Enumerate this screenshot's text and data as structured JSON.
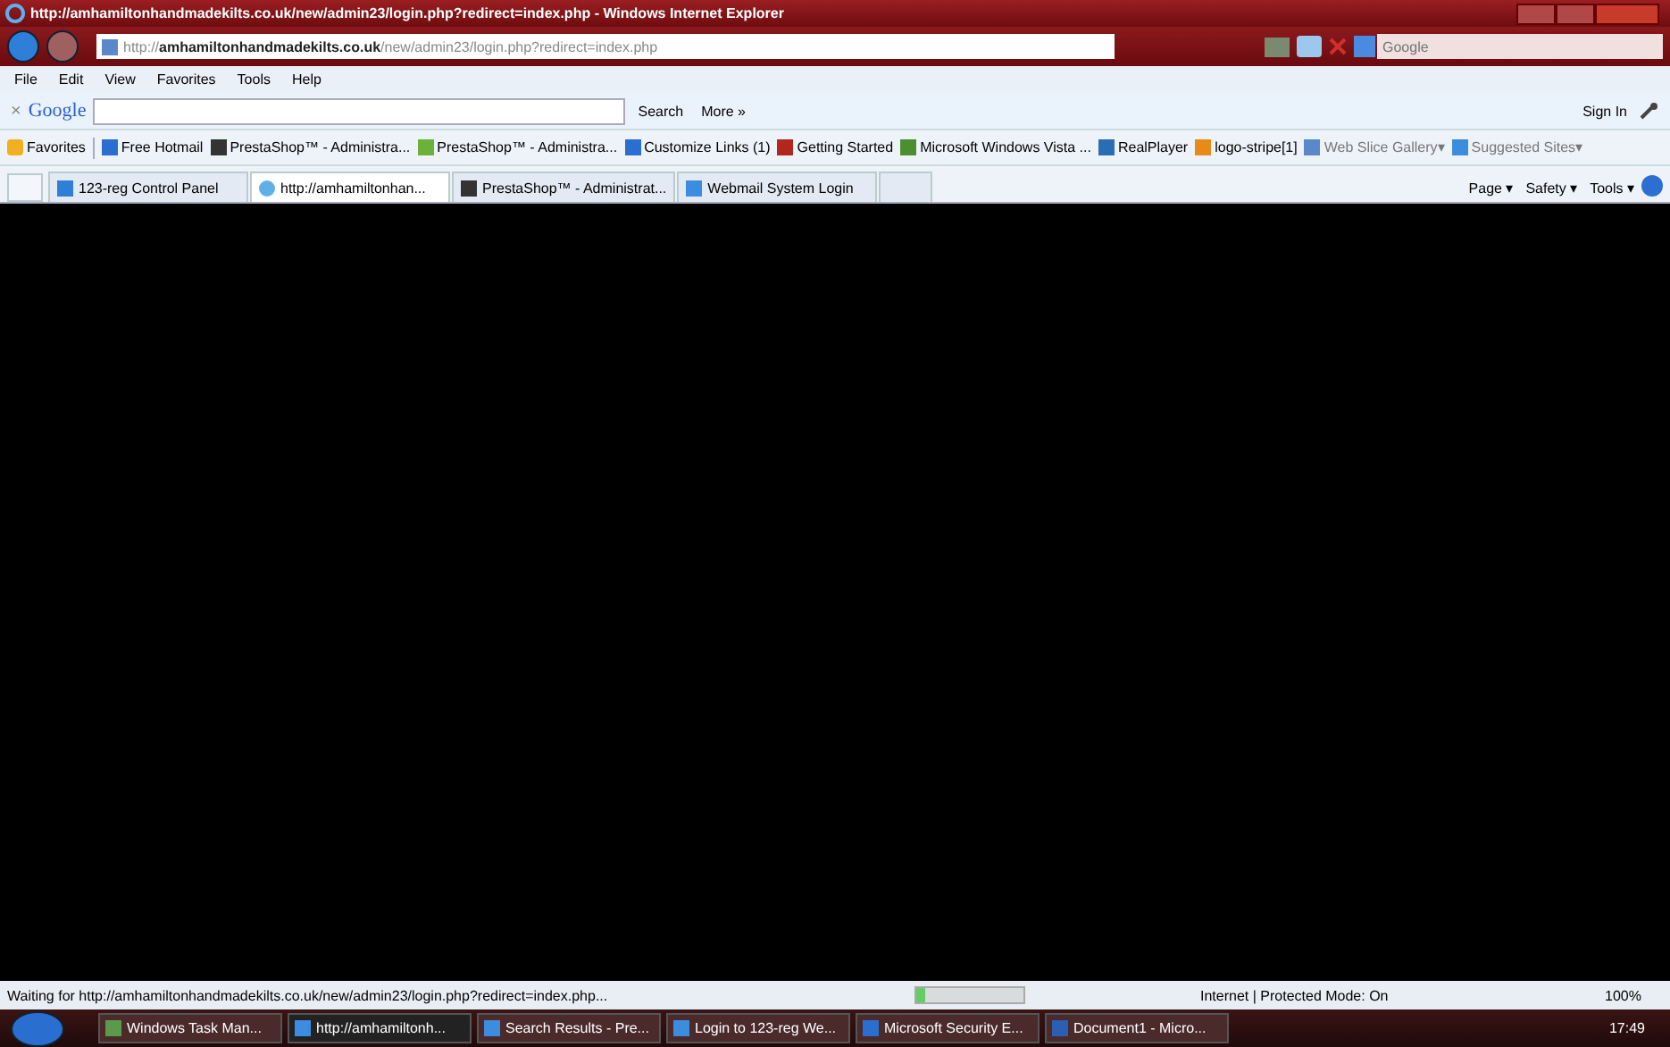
{
  "window": {
    "title": "http://amhamiltonhandmadekilts.co.uk/new/admin23/login.php?redirect=index.php - Windows Internet Explorer"
  },
  "address_bar": {
    "value": "http://**amhamiltonhandmadekilts.co.uk**/new/admin23/login.php?redirect=index.php",
    "search_placeholder": "Google"
  },
  "menu": [
    "File",
    "Edit",
    "View",
    "Favorites",
    "Tools",
    "Help"
  ],
  "google_toolbar": {
    "close": "×",
    "logo": "Google",
    "search": "Search",
    "more": "More »",
    "sign_in": "Sign In"
  },
  "favorites_bar": {
    "label": "Favorites",
    "items": [
      {
        "label": "Free Hotmail",
        "kind": "msn"
      },
      {
        "label": "PrestaShop™ - Administra...",
        "kind": "dark"
      },
      {
        "label": "PrestaShop™ - Administra...",
        "kind": "green"
      },
      {
        "label": "Customize Links (1)",
        "kind": "msn"
      },
      {
        "label": "Getting Started",
        "kind": "red"
      },
      {
        "label": "Microsoft Windows Vista ...",
        "kind": "globe"
      },
      {
        "label": "RealPlayer",
        "kind": "real"
      },
      {
        "label": "logo-stripe[1]",
        "kind": "orange"
      },
      {
        "label": "Web Slice Gallery",
        "kind": "page",
        "dropdown": "▾"
      },
      {
        "label": "Suggested Sites",
        "kind": "ie",
        "dropdown": "▾"
      }
    ]
  },
  "tabs": [
    {
      "label": "123-reg Control Panel",
      "selected": false,
      "kind": "reg"
    },
    {
      "label": "http://amhamiltonhan...",
      "selected": true,
      "kind": "loading"
    },
    {
      "label": "PrestaShop™ - Administrat...",
      "selected": false,
      "kind": "dark"
    },
    {
      "label": "Webmail System Login",
      "selected": false,
      "kind": "ie"
    }
  ],
  "command_bar": [
    {
      "label": "Page",
      "caret": "▾"
    },
    {
      "label": "Safety",
      "caret": "▾"
    },
    {
      "label": "Tools",
      "caret": "▾"
    }
  ],
  "status_bar": {
    "text": "Waiting for http://amhamiltonhandmadekilts.co.uk/new/admin23/login.php?redirect=index.php...",
    "level": 0.08,
    "zone": "Internet | Protected Mode: On",
    "zoom": "100%"
  },
  "taskbar": {
    "items": [
      {
        "label": "Windows Task Man...",
        "selected": false,
        "kind": "monitor"
      },
      {
        "label": "http://amhamiltonh...",
        "selected": true,
        "kind": "ie"
      },
      {
        "label": "Search Results - Pre...",
        "selected": false,
        "kind": "ie"
      },
      {
        "label": "Login to 123-reg We...",
        "selected": false,
        "kind": "ie"
      },
      {
        "label": "Microsoft Security E...",
        "selected": false,
        "kind": "shield"
      },
      {
        "label": "Document1 - Micro...",
        "selected": false,
        "kind": "doc"
      }
    ],
    "clock": "17:49"
  }
}
